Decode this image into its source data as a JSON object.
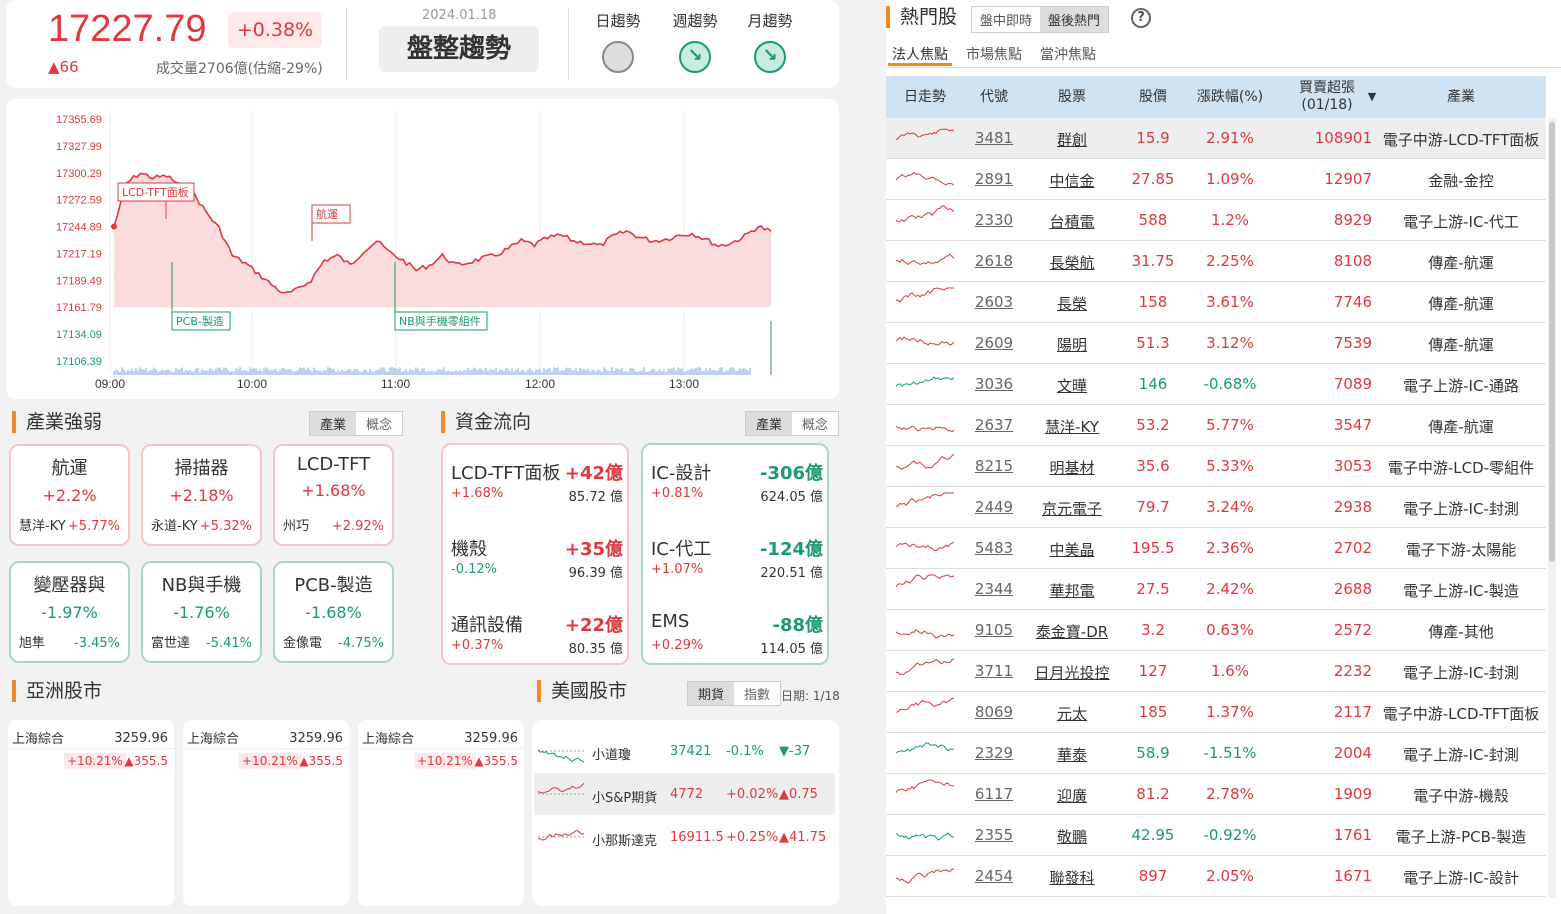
{
  "index": {
    "value": "17227.79",
    "change_pct": "+0.38%",
    "change": "▲66",
    "volume": "成交量2706億(估縮-29%)",
    "date": "2024.01.18",
    "trend": "盤整趨勢",
    "trend_cols": [
      {
        "label": "日趨勢",
        "state": "neutral"
      },
      {
        "label": "週趨勢",
        "state": "down"
      },
      {
        "label": "月趨勢",
        "state": "down"
      }
    ]
  },
  "chart_data": {
    "type": "area",
    "y_ticks": [
      "17355.69",
      "17327.99",
      "17300.29",
      "17272.59",
      "17244.89",
      "17217.19",
      "17189.49",
      "17161.79",
      "17134.09",
      "17106.39"
    ],
    "x_ticks": [
      "09:00",
      "10:00",
      "11:00",
      "12:00",
      "13:00"
    ],
    "ref": 17161.79,
    "series": [
      17245,
      17290,
      17300,
      17295,
      17297,
      17288,
      17280,
      17260,
      17243,
      17215,
      17207,
      17196,
      17185,
      17175,
      17180,
      17190,
      17210,
      17215,
      17205,
      17220,
      17230,
      17218,
      17210,
      17200,
      17205,
      17215,
      17205,
      17208,
      17212,
      17215,
      17222,
      17230,
      17226,
      17233,
      17236,
      17230,
      17228,
      17225,
      17235,
      17240,
      17234,
      17230,
      17232,
      17236,
      17238,
      17232,
      17225,
      17228,
      17235,
      17245,
      17240
    ],
    "annotations": [
      {
        "label": "LCD-TFT面板",
        "color": "#e0383e"
      },
      {
        "label": "航運",
        "color": "#e0383e"
      },
      {
        "label": "PCB-製造",
        "color": "#1a9b6b"
      },
      {
        "label": "NB與手機零組件",
        "color": "#1a9b6b"
      }
    ]
  },
  "industry": {
    "title": "產業強弱",
    "seg": [
      "產業",
      "概念"
    ],
    "items": [
      {
        "name": "航運",
        "pct": "+2.2%",
        "stock": "慧洋-KY",
        "spct": "+5.77%",
        "dir": "up"
      },
      {
        "name": "掃描器",
        "pct": "+2.18%",
        "stock": "永道-KY",
        "spct": "+5.32%",
        "dir": "up"
      },
      {
        "name": "LCD-TFT",
        "pct": "+1.68%",
        "stock": "州巧",
        "spct": "+2.92%",
        "dir": "up"
      },
      {
        "name": "變壓器與",
        "pct": "-1.97%",
        "stock": "旭隼",
        "spct": "-3.45%",
        "dir": "dn"
      },
      {
        "name": "NB與手機",
        "pct": "-1.76%",
        "stock": "富世達",
        "spct": "-5.41%",
        "dir": "dn"
      },
      {
        "name": "PCB-製造",
        "pct": "-1.68%",
        "stock": "金像電",
        "spct": "-4.75%",
        "dir": "dn"
      }
    ]
  },
  "flow": {
    "title": "資金流向",
    "seg": [
      "產業",
      "概念"
    ],
    "in": [
      {
        "name": "LCD-TFT面板",
        "val": "+42億",
        "pct": "+1.68%",
        "amt": "85.72 億"
      },
      {
        "name": "機殼",
        "val": "+35億",
        "pct": "-0.12%",
        "amt": "96.39 億"
      },
      {
        "name": "通訊設備",
        "val": "+22億",
        "pct": "+0.37%",
        "amt": "80.35 億"
      }
    ],
    "out": [
      {
        "name": "IC-設計",
        "val": "-306億",
        "pct": "+0.81%",
        "amt": "624.05 億"
      },
      {
        "name": "IC-代工",
        "val": "-124億",
        "pct": "+1.07%",
        "amt": "220.51 億"
      },
      {
        "name": "EMS",
        "val": "-88億",
        "pct": "+0.29%",
        "amt": "114.05 億"
      }
    ]
  },
  "asia": {
    "title": "亞洲股市",
    "items": [
      {
        "name": "上海綜合",
        "value": "3259.96",
        "pct": "+10.21%",
        "chg": "▲355.5"
      },
      {
        "name": "上海綜合",
        "value": "3259.96",
        "pct": "+10.21%",
        "chg": "▲355.5"
      },
      {
        "name": "上海綜合",
        "value": "3259.96",
        "pct": "+10.21%",
        "chg": "▲355.5"
      }
    ]
  },
  "us": {
    "title": "美國股市",
    "seg": [
      "期貨",
      "指數"
    ],
    "date": "日期: 1/18",
    "items": [
      {
        "name": "小道瓊",
        "value": "37421",
        "pct": "-0.1%",
        "chg": "▼-37",
        "dir": "dn"
      },
      {
        "name": "小S&P期貨",
        "value": "4772",
        "pct": "+0.02%",
        "chg": "▲0.75",
        "dir": "up"
      },
      {
        "name": "小那斯達克",
        "value": "16911.5",
        "pct": "+0.25%",
        "chg": "▲41.75",
        "dir": "up"
      }
    ]
  },
  "hot": {
    "title": "熱門股",
    "seg": [
      "盤中即時",
      "盤後熱門"
    ],
    "tabs": [
      "法人焦點",
      "市場焦點",
      "當沖焦點"
    ],
    "headers": {
      "trend": "日走勢",
      "code": "代號",
      "stock": "股票",
      "price": "股價",
      "chg": "漲跌幅(%)",
      "net1": "買賣超張",
      "net2": "(01/18)",
      "ind": "產業"
    },
    "rows": [
      {
        "code": "3481",
        "name": "群創",
        "price": "15.9",
        "pct": "2.91%",
        "net": "108901",
        "ind": "電子中游-LCD-TFT面板",
        "dir": "up"
      },
      {
        "code": "2891",
        "name": "中信金",
        "price": "27.85",
        "pct": "1.09%",
        "net": "12907",
        "ind": "金融-金控",
        "dir": "up"
      },
      {
        "code": "2330",
        "name": "台積電",
        "price": "588",
        "pct": "1.2%",
        "net": "8929",
        "ind": "電子上游-IC-代工",
        "dir": "up"
      },
      {
        "code": "2618",
        "name": "長榮航",
        "price": "31.75",
        "pct": "2.25%",
        "net": "8108",
        "ind": "傳產-航運",
        "dir": "up"
      },
      {
        "code": "2603",
        "name": "長榮",
        "price": "158",
        "pct": "3.61%",
        "net": "7746",
        "ind": "傳產-航運",
        "dir": "up"
      },
      {
        "code": "2609",
        "name": "陽明",
        "price": "51.3",
        "pct": "3.12%",
        "net": "7539",
        "ind": "傳產-航運",
        "dir": "up"
      },
      {
        "code": "3036",
        "name": "文曄",
        "price": "146",
        "pct": "-0.68%",
        "net": "7089",
        "ind": "電子上游-IC-通路",
        "dir": "dn"
      },
      {
        "code": "2637",
        "name": "慧洋-KY",
        "price": "53.2",
        "pct": "5.77%",
        "net": "3547",
        "ind": "傳產-航運",
        "dir": "up"
      },
      {
        "code": "8215",
        "name": "明基材",
        "price": "35.6",
        "pct": "5.33%",
        "net": "3053",
        "ind": "電子中游-LCD-零組件",
        "dir": "up"
      },
      {
        "code": "2449",
        "name": "京元電子",
        "price": "79.7",
        "pct": "3.24%",
        "net": "2938",
        "ind": "電子上游-IC-封測",
        "dir": "up"
      },
      {
        "code": "5483",
        "name": "中美晶",
        "price": "195.5",
        "pct": "2.36%",
        "net": "2702",
        "ind": "電子下游-太陽能",
        "dir": "up"
      },
      {
        "code": "2344",
        "name": "華邦電",
        "price": "27.5",
        "pct": "2.42%",
        "net": "2688",
        "ind": "電子上游-IC-製造",
        "dir": "up"
      },
      {
        "code": "9105",
        "name": "泰金寶-DR",
        "price": "3.2",
        "pct": "0.63%",
        "net": "2572",
        "ind": "傳產-其他",
        "dir": "up"
      },
      {
        "code": "3711",
        "name": "日月光投控",
        "price": "127",
        "pct": "1.6%",
        "net": "2232",
        "ind": "電子上游-IC-封測",
        "dir": "up"
      },
      {
        "code": "8069",
        "name": "元太",
        "price": "185",
        "pct": "1.37%",
        "net": "2117",
        "ind": "電子中游-LCD-TFT面板",
        "dir": "up"
      },
      {
        "code": "2329",
        "name": "華泰",
        "price": "58.9",
        "pct": "-1.51%",
        "net": "2004",
        "ind": "電子上游-IC-封測",
        "dir": "dn"
      },
      {
        "code": "6117",
        "name": "迎廣",
        "price": "81.2",
        "pct": "2.78%",
        "net": "1909",
        "ind": "電子中游-機殼",
        "dir": "up"
      },
      {
        "code": "2355",
        "name": "敬鵬",
        "price": "42.95",
        "pct": "-0.92%",
        "net": "1761",
        "ind": "電子上游-PCB-製造",
        "dir": "dn"
      },
      {
        "code": "2454",
        "name": "聯發科",
        "price": "897",
        "pct": "2.05%",
        "net": "1671",
        "ind": "電子上游-IC-設計",
        "dir": "up"
      }
    ]
  },
  "colors": {
    "up": "#e0383e",
    "down": "#1a9b6b",
    "accent": "#f08a24",
    "header_bg": "#cfe3f3"
  }
}
